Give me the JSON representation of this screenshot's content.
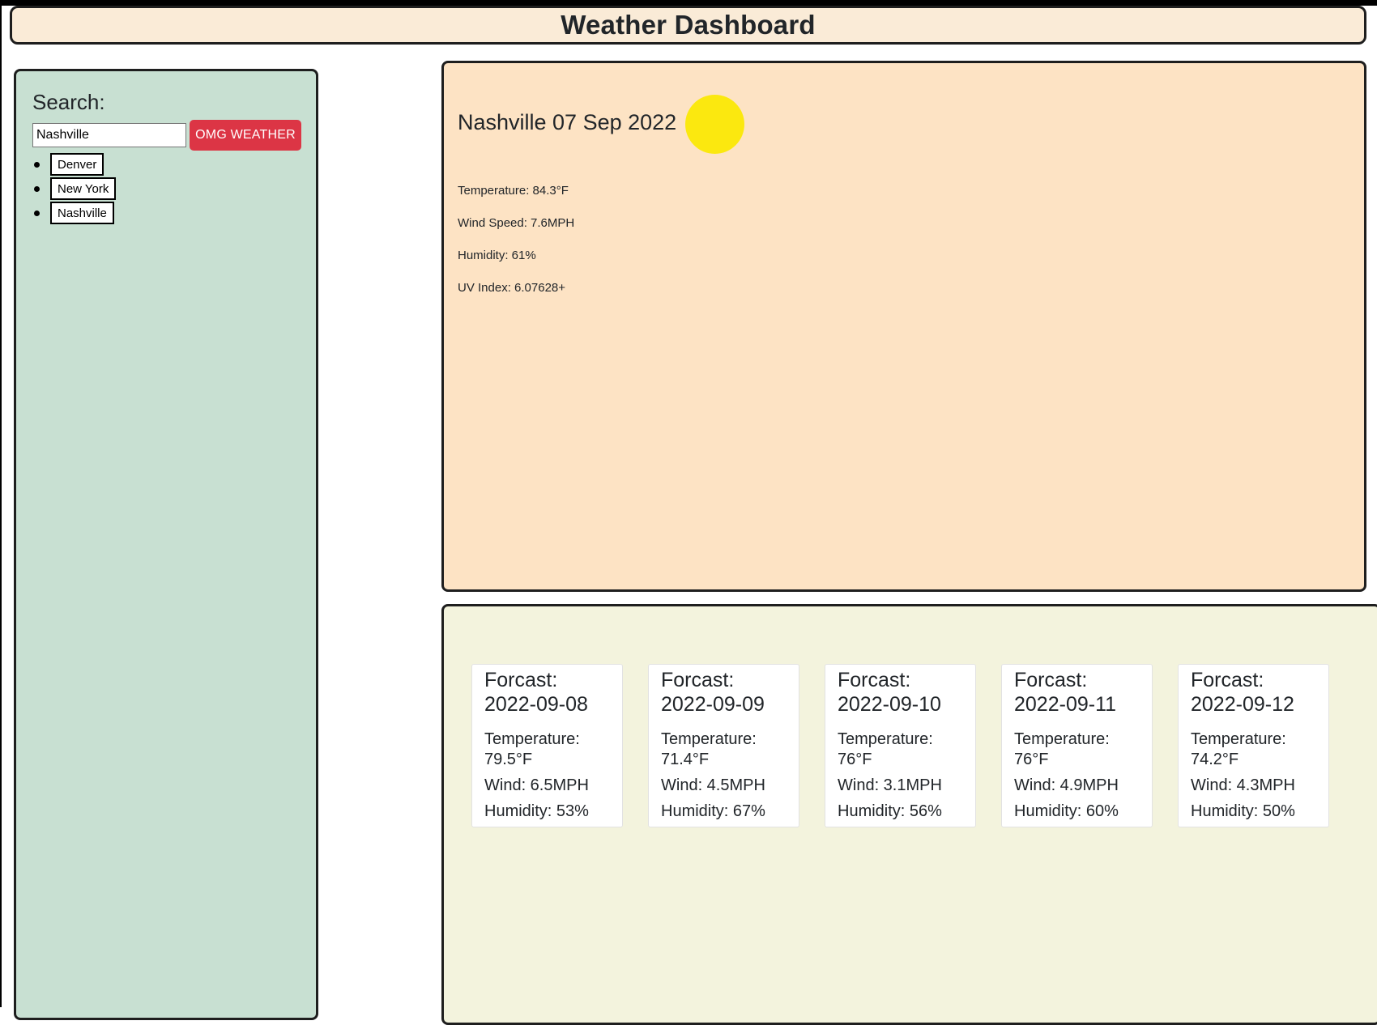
{
  "header": {
    "title": "Weather Dashboard"
  },
  "sidebar": {
    "heading": "Search:",
    "search": {
      "value": "Nashville",
      "button_label": "OMG WEATHER"
    },
    "history": [
      "Denver",
      "New York",
      "Nashville"
    ]
  },
  "current": {
    "title": "Nashville 07 Sep 2022",
    "icon": "sun-icon",
    "temperature": "Temperature: 84.3°F",
    "wind": "Wind Speed: 7.6MPH",
    "humidity": "Humidity: 61%",
    "uv": "UV Index: 6.07628+"
  },
  "forecast": [
    {
      "title_line1": "Forcast:",
      "title_line2": "2022-09-08",
      "temp_label": "Temperature:",
      "temp": "79.5°F",
      "wind": "Wind: 6.5MPH",
      "humidity": "Humidity: 53%"
    },
    {
      "title_line1": "Forcast:",
      "title_line2": "2022-09-09",
      "temp_label": "Temperature:",
      "temp": "71.4°F",
      "wind": "Wind: 4.5MPH",
      "humidity": "Humidity: 67%"
    },
    {
      "title_line1": "Forcast:",
      "title_line2": "2022-09-10",
      "temp_label": "Temperature:",
      "temp": "76°F",
      "wind": "Wind: 3.1MPH",
      "humidity": "Humidity: 56%"
    },
    {
      "title_line1": "Forcast:",
      "title_line2": "2022-09-11",
      "temp_label": "Temperature:",
      "temp": "76°F",
      "wind": "Wind: 4.9MPH",
      "humidity": "Humidity: 60%"
    },
    {
      "title_line1": "Forcast:",
      "title_line2": "2022-09-12",
      "temp_label": "Temperature:",
      "temp": "74.2°F",
      "wind": "Wind: 4.3MPH",
      "humidity": "Humidity: 50%"
    }
  ],
  "colors": {
    "header_bg": "#faebd7",
    "sidebar_bg": "#c8e0d2",
    "current_bg": "#fde3c4",
    "forecast_bg": "#f3f3dd",
    "button_red": "#dc3545",
    "sun_yellow": "#fbe80f"
  }
}
